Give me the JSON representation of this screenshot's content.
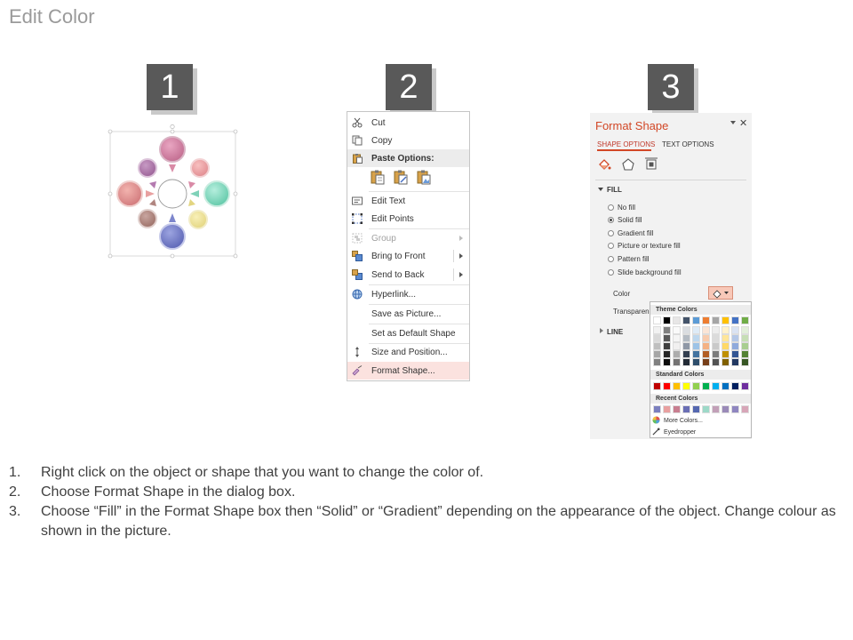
{
  "page_title": "Edit Color",
  "steps": [
    {
      "number": "1"
    },
    {
      "number": "2"
    },
    {
      "number": "3"
    }
  ],
  "context_menu": {
    "items": [
      {
        "label": "Cut",
        "icon": "scissors-icon",
        "state": "normal"
      },
      {
        "label": "Copy",
        "icon": "copy-icon",
        "state": "normal"
      },
      {
        "label": "Paste Options:",
        "icon": "clipboard-icon",
        "state": "header"
      },
      {
        "label": "Edit Text",
        "icon": "edit-text-icon",
        "state": "normal"
      },
      {
        "label": "Edit Points",
        "icon": "edit-points-icon",
        "state": "normal"
      },
      {
        "label": "Group",
        "icon": "group-icon",
        "state": "disabled",
        "submenu": true
      },
      {
        "label": "Bring to Front",
        "icon": "bring-to-front-icon",
        "state": "normal",
        "submenu": true
      },
      {
        "label": "Send to Back",
        "icon": "send-to-back-icon",
        "state": "normal",
        "submenu": true
      },
      {
        "label": "Hyperlink...",
        "icon": "hyperlink-icon",
        "state": "normal"
      },
      {
        "label": "Save as Picture...",
        "icon": "",
        "state": "normal"
      },
      {
        "label": "Set as Default Shape",
        "icon": "",
        "state": "normal"
      },
      {
        "label": "Size and Position...",
        "icon": "size-position-icon",
        "state": "normal"
      },
      {
        "label": "Format Shape...",
        "icon": "format-shape-icon",
        "state": "highlighted"
      }
    ]
  },
  "format_pane": {
    "title": "Format Shape",
    "tabs": [
      "SHAPE OPTIONS",
      "TEXT OPTIONS"
    ],
    "active_tab": "SHAPE OPTIONS",
    "icons": [
      "fill-line-icon",
      "effects-icon",
      "size-properties-icon"
    ],
    "fill_section": "FILL",
    "fill_options": [
      {
        "label": "No fill",
        "checked": false
      },
      {
        "label": "Solid fill",
        "checked": true
      },
      {
        "label": "Gradient fill",
        "checked": false
      },
      {
        "label": "Picture or texture fill",
        "checked": false
      },
      {
        "label": "Pattern fill",
        "checked": false
      },
      {
        "label": "Slide background fill",
        "checked": false
      }
    ],
    "color_label": "Color",
    "transparency_label": "Transparency",
    "line_section": "LINE"
  },
  "palette": {
    "theme_colors_label": "Theme Colors",
    "standard_colors_label": "Standard Colors",
    "recent_colors_label": "Recent Colors",
    "more_colors_label": "More Colors...",
    "eyedropper_label": "Eyedropper",
    "theme_base": [
      "#ffffff",
      "#000000",
      "#e7e6e6",
      "#44546a",
      "#5b9bd5",
      "#ed7d31",
      "#a5a5a5",
      "#ffc000",
      "#4472c4",
      "#70ad47"
    ],
    "standard": [
      "#c00000",
      "#ff0000",
      "#ffc000",
      "#ffff00",
      "#92d050",
      "#00b050",
      "#00b0f0",
      "#0070c0",
      "#002060",
      "#7030a0"
    ],
    "recent": [
      "#7b7fbf",
      "#e8a0a0",
      "#c87e90",
      "#6a6fb5",
      "#5568b0",
      "#9dd9c8",
      "#c2a0b8",
      "#9a8ab8",
      "#8f86c0",
      "#d7a6b8"
    ]
  },
  "instructions": [
    {
      "num": "1.",
      "text": "Right click on the object or shape that you want to change the color of."
    },
    {
      "num": "2.",
      "text": "Choose Format Shape in the dialog box."
    },
    {
      "num": "3.",
      "text": "Choose “Fill” in the Format Shape box then “Solid” or “Gradient” depending on the appearance of the object. Change colour as shown in the picture."
    }
  ]
}
